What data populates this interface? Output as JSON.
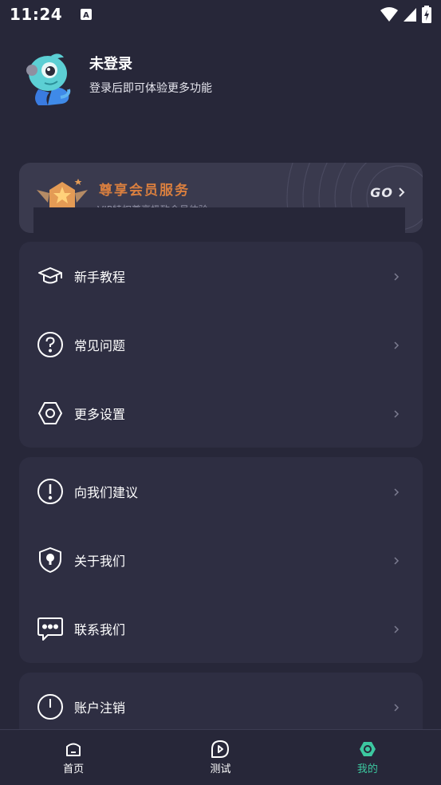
{
  "status_bar": {
    "time": "11:24"
  },
  "profile": {
    "name": "未登录",
    "subtitle": "登录后即可体验更多功能"
  },
  "vip": {
    "title": "尊享会员服务",
    "subtitle": "VIP特权尊享极致会员体验",
    "go_label": "GO"
  },
  "menu_groups": [
    {
      "items": [
        {
          "label": "新手教程",
          "icon": "graduation-cap-icon"
        },
        {
          "label": "常见问题",
          "icon": "question-circle-icon"
        },
        {
          "label": "更多设置",
          "icon": "hexagon-settings-icon"
        }
      ]
    },
    {
      "items": [
        {
          "label": "向我们建议",
          "icon": "exclamation-circle-icon"
        },
        {
          "label": "关于我们",
          "icon": "shield-icon"
        },
        {
          "label": "联系我们",
          "icon": "chat-bubble-icon"
        }
      ]
    },
    {
      "items": [
        {
          "label": "账户注销",
          "icon": "power-icon"
        }
      ]
    }
  ],
  "bottom_nav": [
    {
      "label": "首页",
      "icon": "home-icon",
      "active": false
    },
    {
      "label": "测试",
      "icon": "test-play-icon",
      "active": false
    },
    {
      "label": "我的",
      "icon": "profile-hexagon-icon",
      "active": true
    }
  ],
  "colors": {
    "background": "#272739",
    "card": "#2e2e42",
    "accent": "#3cc8a0",
    "vip_title": "#d97f3f"
  }
}
